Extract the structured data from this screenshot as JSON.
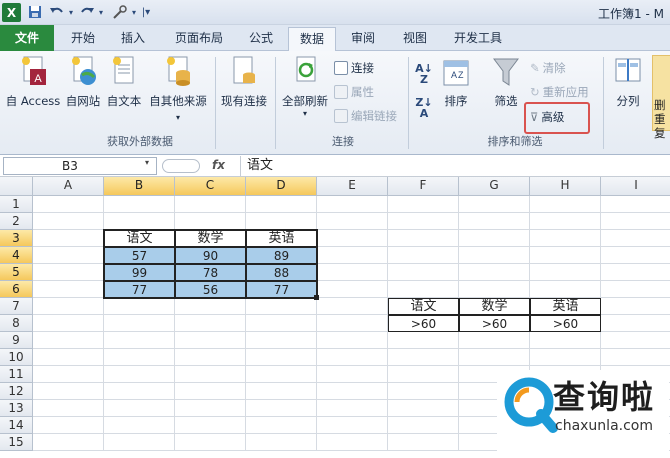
{
  "window": {
    "title": "工作簿1 - M"
  },
  "quick_access": {
    "app_icon": "excel-icon",
    "save": "save-icon",
    "undo": "undo-icon",
    "redo": "redo-icon",
    "customize": "customize-icon"
  },
  "tabs": [
    "文件",
    "开始",
    "插入",
    "页面布局",
    "公式",
    "数据",
    "审阅",
    "视图",
    "开发工具"
  ],
  "ribbon": {
    "external": {
      "access": "自 Access",
      "web": "自网站",
      "text": "自文本",
      "other": "自其他来源",
      "existing": "现有连接",
      "label": "获取外部数据"
    },
    "connections": {
      "refresh_all": "全部刷新",
      "connections": "连接",
      "properties": "属性",
      "edit_links": "编辑链接",
      "label": "连接"
    },
    "sort_filter": {
      "sort": "排序",
      "filter": "筛选",
      "clear": "清除",
      "reapply": "重新应用",
      "advanced": "高级",
      "label": "排序和筛选"
    },
    "tools": {
      "text_to_columns": "分列",
      "delete": "删",
      "remove_dup": "重复"
    },
    "highlight_color": "#d9534f"
  },
  "formula_bar": {
    "name_box": "B3",
    "fx": "fx",
    "value": "语文"
  },
  "columns": [
    "A",
    "B",
    "C",
    "D",
    "E",
    "F",
    "G",
    "H",
    "I"
  ],
  "selected_columns": [
    "B",
    "C",
    "D"
  ],
  "rows": [
    "1",
    "2",
    "3",
    "4",
    "5",
    "6",
    "7",
    "8",
    "9",
    "10",
    "11",
    "12",
    "13",
    "14",
    "15"
  ],
  "selected_rows": [
    "3",
    "4",
    "5",
    "6"
  ],
  "table1": {
    "headers": [
      "语文",
      "数学",
      "英语"
    ],
    "rows": [
      [
        "57",
        "90",
        "89"
      ],
      [
        "99",
        "78",
        "88"
      ],
      [
        "77",
        "56",
        "77"
      ]
    ],
    "fill": "#a9cdea"
  },
  "table2": {
    "headers": [
      "语文",
      "数学",
      "英语"
    ],
    "criteria": [
      ">60",
      ">60",
      ">60"
    ]
  },
  "watermark": {
    "name": "查询啦",
    "url": "chaxunla.com"
  }
}
